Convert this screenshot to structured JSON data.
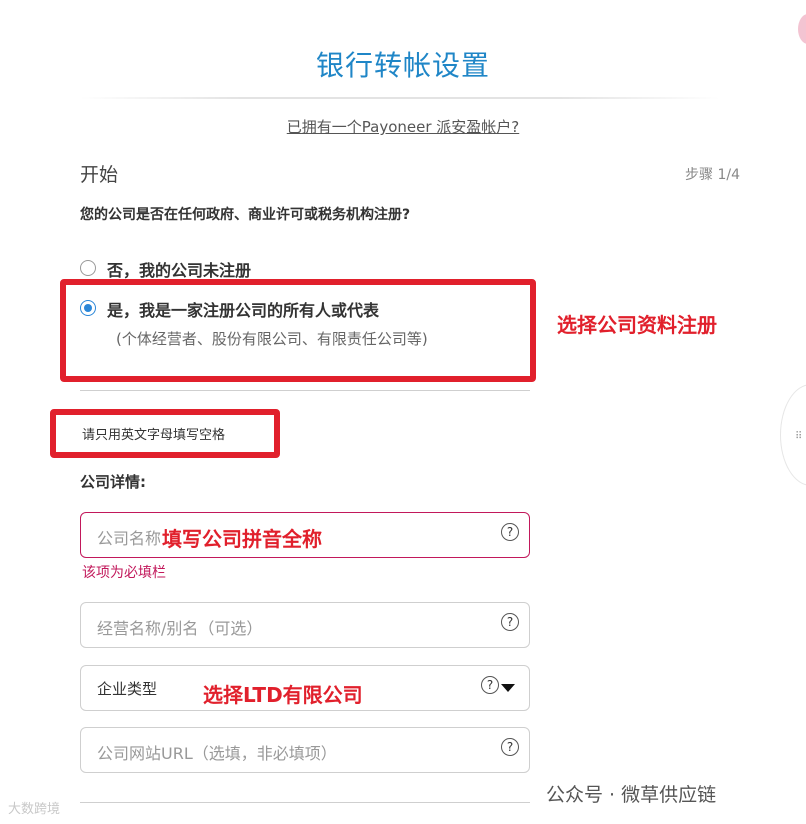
{
  "header": {
    "title": "银行转帐设置",
    "existing_account_link": "已拥有一个Payoneer 派安盈帐户?"
  },
  "step": {
    "heading": "开始",
    "indicator": "步骤 1/4"
  },
  "question": {
    "text": "您的公司是否在任何政府、商业许可或税务机构注册?",
    "options": [
      {
        "label": "否，我的公司未注册",
        "checked": false
      },
      {
        "label": "是，我是一家注册公司的所有人或代表",
        "sublabel": "(个体经营者、股份有限公司、有限责任公司等)",
        "checked": true
      }
    ]
  },
  "hint": "请只用英文字母填写空格",
  "company_details": {
    "title": "公司详情:",
    "fields": {
      "company_name": {
        "placeholder": "公司名称",
        "error": "该项为必填栏"
      },
      "dba_name": {
        "placeholder": "经营名称/别名（可选）"
      },
      "company_type": {
        "value": "企业类型"
      },
      "website": {
        "placeholder": "公司网站URL（选填，非必填项）"
      }
    },
    "help_glyph": "?"
  },
  "annotations": {
    "select_registration": "选择公司资料注册",
    "fill_company_name": "填写公司拼音全称",
    "select_ltd": "选择LTD有限公司"
  },
  "watermarks": {
    "left": "大数跨境",
    "right": "公众号 · 微草供应链"
  },
  "colors": {
    "title_blue": "#1f86c7",
    "annotation_red": "#e1202c",
    "error": "#c2185b",
    "radio_blue": "#2a86d8"
  }
}
